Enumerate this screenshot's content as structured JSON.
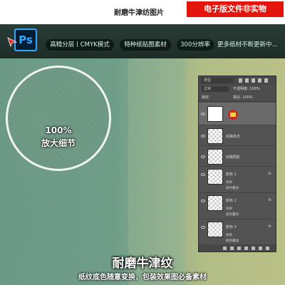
{
  "header": {
    "title": "耐磨牛津纺图片",
    "badge": "电子版文件非实物"
  },
  "banner": {
    "app_logo": "Ps",
    "tags": [
      "高精分层丨CMYK模式",
      "特种纸贴图素材",
      "300分辨率"
    ],
    "more": "更多纸材不断更新中..."
  },
  "zoom": {
    "percent": "100%",
    "label": "放大细节"
  },
  "layers_panel": {
    "kind_filter": "类型",
    "blend_mode": "正常",
    "opacity_label": "不透明度: 100%",
    "lock_label": "锁定:",
    "fill_label": "填充: 100%",
    "layers": [
      {
        "name": "",
        "thumb": "white-with-logo",
        "selected": true
      },
      {
        "name": "纹路高光",
        "thumb": "checker"
      },
      {
        "name": "纹路阴影",
        "thumb": "checker"
      },
      {
        "name": "颜色 1",
        "thumb": "checker",
        "fx": "fx",
        "effects": [
          "效果",
          "颜色叠加"
        ]
      },
      {
        "name": "颜色 2",
        "thumb": "checker",
        "fx": "fx",
        "effects": [
          "效果",
          "颜色叠加"
        ]
      },
      {
        "name": "颜色 3",
        "thumb": "checker",
        "fx": "fx",
        "effects": [
          "效果",
          "颜色叠加"
        ]
      }
    ]
  },
  "caption": {
    "title": "耐磨牛津纹",
    "subtitle": "纸纹底色随意变换，包装效果图必备素材"
  },
  "colors": {
    "badge_red": "#e3150c",
    "ps_blue": "#31a8ff",
    "banner_dark": "#1d2c27",
    "texture_green": "#6e9e88"
  }
}
